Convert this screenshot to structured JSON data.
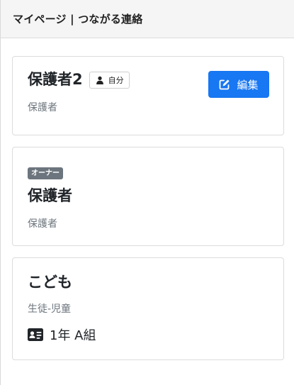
{
  "header": {
    "title": "マイページ | つながる連絡"
  },
  "cards": [
    {
      "name": "保護者2",
      "self_badge": "自分",
      "role": "保護者",
      "edit_label": "編集"
    },
    {
      "badge": "オーナー",
      "name": "保護者",
      "role": "保護者"
    },
    {
      "name": "こども",
      "role": "生徒-児童",
      "class": "1年 A組"
    }
  ],
  "colors": {
    "primary": "#1877f2",
    "badge_gray": "#6c757d",
    "muted_text": "#6c757d"
  },
  "icons": {
    "self_badge": "person-icon",
    "edit": "edit-icon",
    "class": "id-card-icon"
  }
}
